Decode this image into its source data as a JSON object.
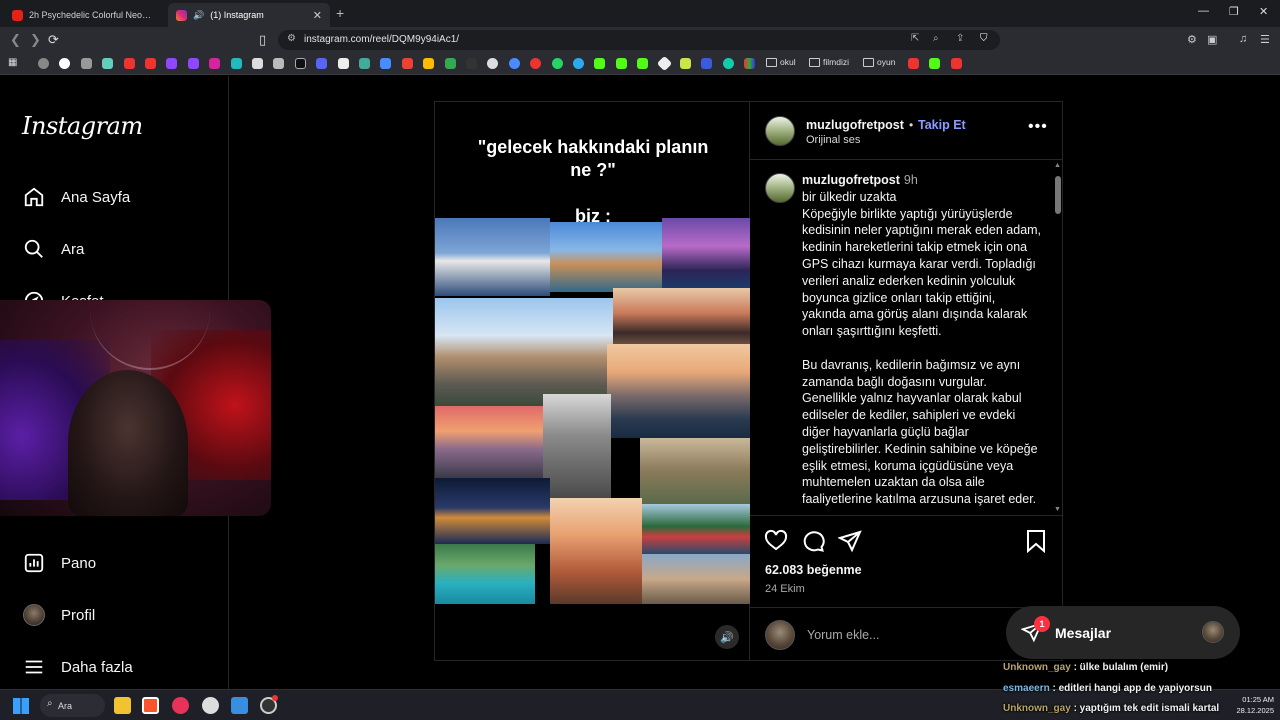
{
  "browser": {
    "tabs": [
      {
        "title": "2h Psychedelic Colorful Neon Backgr",
        "favicon_color": "#e62117"
      },
      {
        "title": "(1) Instagram",
        "favicon_color": "#d6249f",
        "audio": "speaker-icon"
      }
    ],
    "new_tab": "+",
    "url": "instagram.com/reel/DQM9y94iAc1/",
    "bookmark_folders": [
      "okul",
      "filmdizi",
      "oyun"
    ]
  },
  "sidebar": {
    "logo": "Instagram",
    "items": [
      {
        "label": "Ana Sayfa",
        "icon": "home-icon"
      },
      {
        "label": "Ara",
        "icon": "search-icon"
      },
      {
        "label": "Keşfet",
        "icon": "explore-icon"
      },
      {
        "label": "Pano",
        "icon": "dashboard-icon"
      },
      {
        "label": "Profil",
        "icon": "profile-avatar"
      },
      {
        "label": "Daha fazla",
        "icon": "menu-icon"
      }
    ]
  },
  "reel": {
    "caption_line1": "\"gelecek hakkındaki planın",
    "caption_line2": "ne ?\"",
    "caption_line3": "biz :"
  },
  "post": {
    "username": "muzlugofretpost",
    "follow": "Takip Et",
    "separator": "•",
    "audio": "Orijinal ses",
    "comment_username": "muzlugofretpost",
    "time": "9h",
    "caption": [
      "bir ülkedir uzakta\nKöpeğiyle birlikte yaptığı yürüyüşlerde kedisinin neler yaptığını merak eden adam, kedinin hareketlerini takip etmek için ona GPS cihazı kurmaya karar verdi. Topladığı verileri analiz ederken kedinin yolculuk boyunca gizlice onları takip ettiğini, yakında ama görüş alanı dışında kalarak onları şaşırttığını keşfetti.",
      "Bu davranış, kedilerin bağımsız ve aynı zamanda bağlı doğasını vurgular. Genellikle yalnız hayvanlar olarak kabul edilseler de kediler, sahipleri ve evdeki diğer hayvanlarla güçlü bağlar geliştirebilirler. Kedinin sahibine ve köpeğe eşlik etmesi, koruma içgüdüsüne veya muhtemelen uzaktan da olsa aile faaliyetlerine katılma arzusuna işaret eder."
    ],
    "likes": "62.083 beğenme",
    "date": "24 Ekim",
    "comment_placeholder": "Yorum ekle..."
  },
  "messages": {
    "label": "Mesajlar",
    "badge": "1"
  },
  "chat": [
    {
      "user": "Unknown_gay",
      "text": " : ülke bulalım (emir)"
    },
    {
      "user": "esmaeern",
      "text": " : editleri hangi app de yapiyorsun"
    },
    {
      "user": "Unknown_gay",
      "text": " : yaptığım tek edit ismali kartal"
    }
  ],
  "taskbar": {
    "search": "Ara",
    "time": "01:25 AM",
    "date": "28.12.2025"
  },
  "colors": {
    "accent": "#0095f6",
    "follow": "#8a9cff",
    "background": "#000000"
  }
}
